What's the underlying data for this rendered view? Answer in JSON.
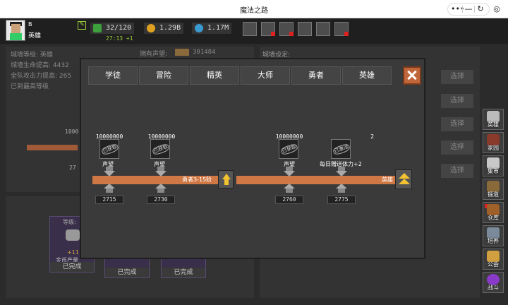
{
  "window": {
    "title": "魔法之路",
    "controls": [
      "more-icon",
      "minimize-icon",
      "refresh-icon",
      "target-icon"
    ]
  },
  "player": {
    "name": "B",
    "title": "英雄"
  },
  "resources": {
    "energy": "32/120",
    "energy_regen": "27:13 +1",
    "gold": "1.29B",
    "gems": "1.17M"
  },
  "top_icons": [
    "shop-icon",
    "mail-icon",
    "gamepad-icon",
    "gear-icon",
    "palette-icon",
    "chest-icon"
  ],
  "background": {
    "fame_label": "拥有声望:",
    "fame_value": "301484",
    "wall_level": "城墙等级: 英雄",
    "wall_hp": "城墙生命提高: 4432",
    "team_attack": "全队攻击力提高: 265",
    "max_level": "已到最高等级",
    "wall_settings": "城墙设定:",
    "select_label": "选择",
    "left_val_top": "1000",
    "left_val_bottom": "27",
    "card_top_label": "等级:",
    "card_done_label": "已完成",
    "card_inner_text": "+11",
    "card_inner_label": "金币产量"
  },
  "sidebar": [
    {
      "label": "英雄",
      "icon": "hero-icon"
    },
    {
      "label": "家园",
      "icon": "house-icon"
    },
    {
      "label": "集市",
      "icon": "market-icon"
    },
    {
      "label": "锻造",
      "icon": "anvil-icon"
    },
    {
      "label": "仓库",
      "icon": "warehouse-icon"
    },
    {
      "label": "培养",
      "icon": "training-icon"
    },
    {
      "label": "公会",
      "icon": "guild-icon"
    },
    {
      "label": "战斗",
      "icon": "battle-icon"
    }
  ],
  "modal": {
    "tabs": [
      "学徒",
      "冒险",
      "精英",
      "大师",
      "勇者",
      "英雄"
    ],
    "nodes": [
      {
        "value": "10000000",
        "stamp": "已获取",
        "sub": "声望",
        "points": "2715"
      },
      {
        "value": "10000000",
        "stamp": "已获取",
        "sub": "声望",
        "points": "2730"
      },
      {
        "value": "10000000",
        "stamp": "已获取",
        "sub": "声望",
        "points": "2760"
      },
      {
        "value": "2",
        "stamp": "已激活",
        "sub": "每日赠送体力+2",
        "points": "2775"
      }
    ],
    "track_label_mid": "勇者3-15阶",
    "track_label_right": "英雄"
  }
}
